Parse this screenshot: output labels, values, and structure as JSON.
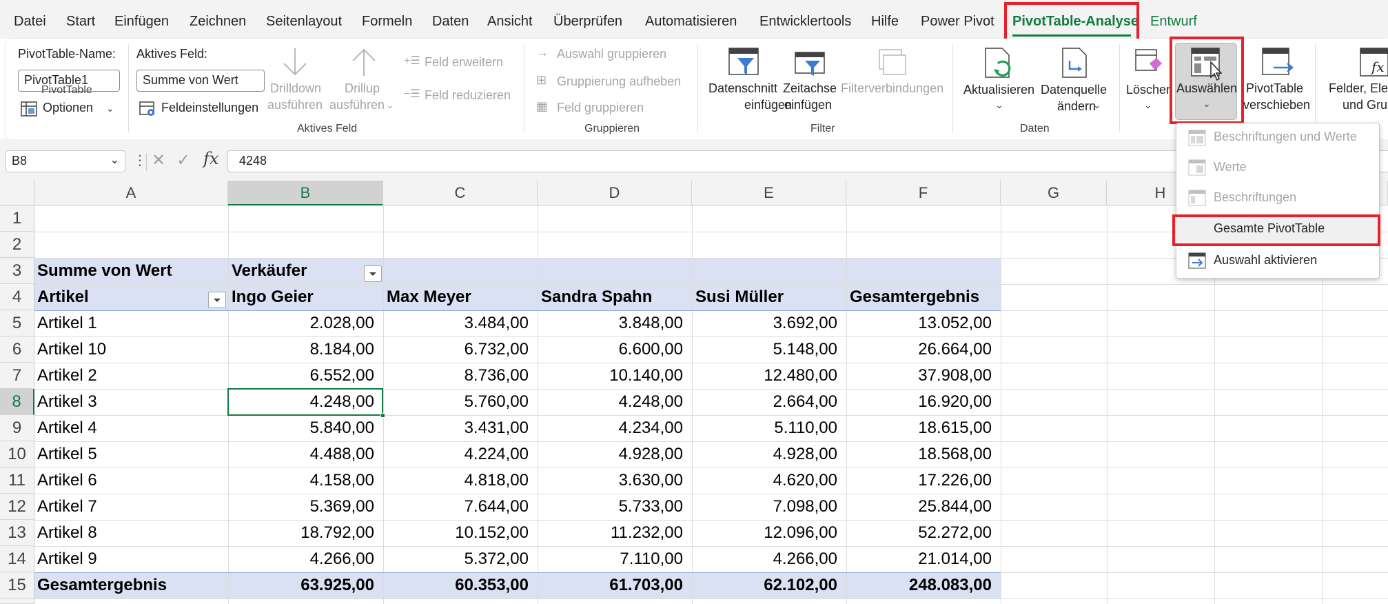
{
  "tabs": [
    "Datei",
    "Start",
    "Einfügen",
    "Zeichnen",
    "Seitenlayout",
    "Formeln",
    "Daten",
    "Ansicht",
    "Überprüfen",
    "Automatisieren",
    "Entwicklertools",
    "Hilfe",
    "Power Pivot",
    "PivotTable-Analyse",
    "Entwurf"
  ],
  "active_tab": "PivotTable-Analyse",
  "ribbon": {
    "pivottable": {
      "name_label": "PivotTable-Name:",
      "name_value": "PivotTable1",
      "options_label": "Optionen",
      "group_label": "PivotTable"
    },
    "active_field": {
      "label": "Aktives Feld:",
      "value": "Summe von Wert",
      "settings_label": "Feldeinstellungen",
      "drilldown_l1": "Drilldown",
      "drilldown_l2": "ausführen",
      "drillup_l1": "Drillup",
      "drillup_l2": "ausführen",
      "expand_label": "Feld erweitern",
      "collapse_label": "Feld reduzieren",
      "group_label": "Aktives Feld"
    },
    "group": {
      "group_selection": "Auswahl gruppieren",
      "ungroup": "Gruppierung aufheben",
      "group_field": "Feld gruppieren",
      "group_label": "Gruppieren"
    },
    "filter": {
      "slicer_l1": "Datenschnitt",
      "slicer_l2": "einfügen",
      "timeline_l1": "Zeitachse",
      "timeline_l2": "einfügen",
      "connections": "Filterverbindungen",
      "group_label": "Filter"
    },
    "data": {
      "refresh": "Aktualisieren",
      "source_l1": "Datenquelle",
      "source_l2": "ändern",
      "group_label": "Daten"
    },
    "actions": {
      "clear": "Löschen",
      "select": "Auswählen",
      "move_l1": "PivotTable",
      "move_l2": "verschieben"
    },
    "calculations": {
      "fields_l1": "Felder, Elem",
      "fields_l2": "und Grupp"
    }
  },
  "formula_bar": {
    "name_box": "B8",
    "formula": "4248"
  },
  "columns": [
    "A",
    "B",
    "C",
    "D",
    "E",
    "F",
    "G",
    "H"
  ],
  "selected_column": "B",
  "rows": [
    "1",
    "2",
    "3",
    "4",
    "5",
    "6",
    "7",
    "8",
    "9",
    "10",
    "11",
    "12",
    "13",
    "14",
    "15"
  ],
  "selected_row": "8",
  "pivot": {
    "corner_label": "Summe von Wert",
    "col_field": "Verkäufer",
    "row_field": "Artikel",
    "columns": [
      "Ingo Geier",
      "Max Meyer",
      "Sandra Spahn",
      "Susi Müller",
      "Gesamtergebnis"
    ],
    "rows": [
      {
        "label": "Artikel 1",
        "values": [
          "2.028,00",
          "3.484,00",
          "3.848,00",
          "3.692,00",
          "13.052,00"
        ]
      },
      {
        "label": "Artikel 10",
        "values": [
          "8.184,00",
          "6.732,00",
          "6.600,00",
          "5.148,00",
          "26.664,00"
        ]
      },
      {
        "label": "Artikel 2",
        "values": [
          "6.552,00",
          "8.736,00",
          "10.140,00",
          "12.480,00",
          "37.908,00"
        ]
      },
      {
        "label": "Artikel 3",
        "values": [
          "4.248,00",
          "5.760,00",
          "4.248,00",
          "2.664,00",
          "16.920,00"
        ]
      },
      {
        "label": "Artikel 4",
        "values": [
          "5.840,00",
          "3.431,00",
          "4.234,00",
          "5.110,00",
          "18.615,00"
        ]
      },
      {
        "label": "Artikel 5",
        "values": [
          "4.488,00",
          "4.224,00",
          "4.928,00",
          "4.928,00",
          "18.568,00"
        ]
      },
      {
        "label": "Artikel 6",
        "values": [
          "4.158,00",
          "4.818,00",
          "3.630,00",
          "4.620,00",
          "17.226,00"
        ]
      },
      {
        "label": "Artikel 7",
        "values": [
          "5.369,00",
          "7.644,00",
          "5.733,00",
          "7.098,00",
          "25.844,00"
        ]
      },
      {
        "label": "Artikel 8",
        "values": [
          "18.792,00",
          "10.152,00",
          "11.232,00",
          "12.096,00",
          "52.272,00"
        ]
      },
      {
        "label": "Artikel 9",
        "values": [
          "4.266,00",
          "5.372,00",
          "7.110,00",
          "4.266,00",
          "21.014,00"
        ]
      }
    ],
    "total": {
      "label": "Gesamtergebnis",
      "values": [
        "63.925,00",
        "60.353,00",
        "61.703,00",
        "62.102,00",
        "248.083,00"
      ]
    }
  },
  "select_menu": {
    "items": [
      {
        "label": "Beschriftungen und Werte",
        "enabled": false
      },
      {
        "label": "Werte",
        "enabled": false
      },
      {
        "label": "Beschriftungen",
        "enabled": false
      },
      {
        "label": "Gesamte PivotTable",
        "enabled": true
      },
      {
        "label": "Auswahl aktivieren",
        "enabled": true
      }
    ]
  },
  "colors": {
    "accent_green": "#107c41",
    "highlight_red": "#e8202a",
    "pivot_band": "#d9e1f2"
  }
}
